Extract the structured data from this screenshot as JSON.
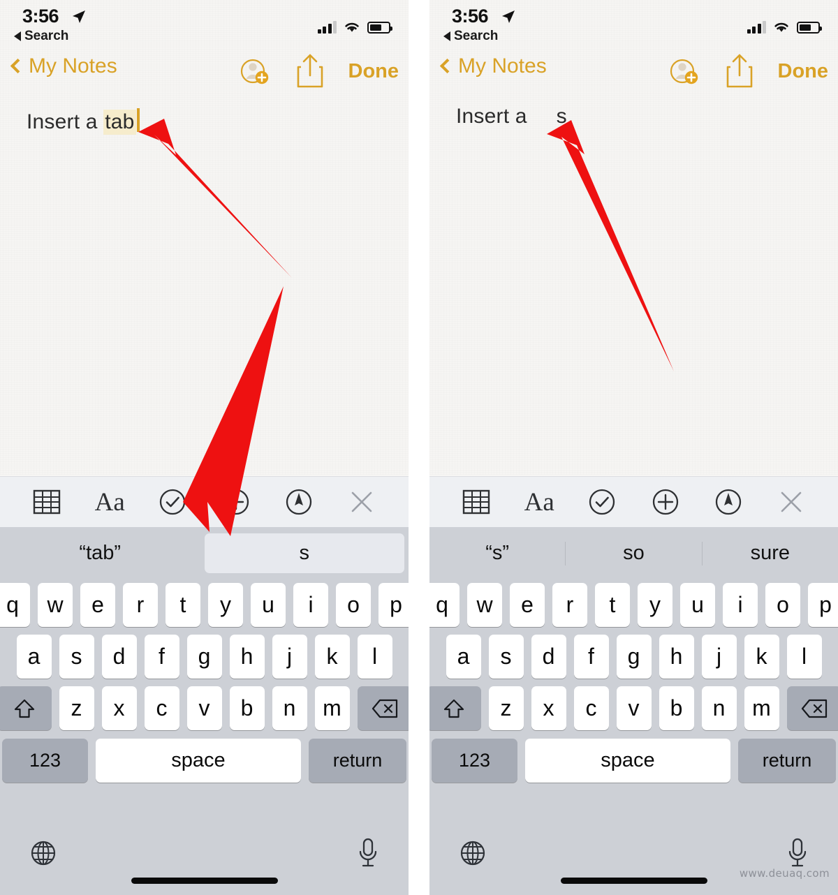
{
  "status_bar": {
    "time": "3:56",
    "back_app": "Search",
    "location_icon": "location-arrow-icon",
    "signal_icon": "cellular-signal-icon",
    "wifi_icon": "wifi-icon",
    "battery_icon": "battery-icon",
    "battery_level_pct": 62
  },
  "nav_bar": {
    "back_label": "My Notes",
    "back_chevron_icon": "chevron-left-icon",
    "add_person_icon": "add-person-icon",
    "share_icon": "share-icon",
    "done_label": "Done",
    "accent_color": "#d9a227"
  },
  "panels": [
    {
      "id": "before",
      "note": {
        "prefix": "Insert a ",
        "highlighted_word": "tab",
        "has_caret": true,
        "tab_inserted": false,
        "suffix": ""
      },
      "suggestions": [
        {
          "label": "“tab”",
          "highlighted": false
        },
        {
          "label": "s",
          "highlighted": true
        }
      ],
      "arrows": [
        {
          "name": "arrow-to-note-text",
          "points_to": "tab"
        },
        {
          "name": "arrow-to-suggestion",
          "points_to": "s"
        }
      ]
    },
    {
      "id": "after",
      "note": {
        "prefix": "Insert a",
        "highlighted_word": "",
        "has_caret": false,
        "tab_inserted": true,
        "suffix": "s"
      },
      "suggestions": [
        {
          "label": "“s”",
          "highlighted": false
        },
        {
          "label": "so",
          "highlighted": false
        },
        {
          "label": "sure",
          "highlighted": false
        }
      ],
      "arrows": [
        {
          "name": "arrow-to-note-text",
          "points_to": "s"
        }
      ]
    }
  ],
  "format_toolbar": {
    "items": [
      {
        "icon": "table-icon",
        "label": ""
      },
      {
        "icon": "text-format-icon",
        "label": "Aa"
      },
      {
        "icon": "checklist-circle-icon",
        "label": ""
      },
      {
        "icon": "plus-circle-icon",
        "label": ""
      },
      {
        "icon": "markup-pen-circle-icon",
        "label": ""
      },
      {
        "icon": "close-x-icon",
        "label": ""
      }
    ]
  },
  "keyboard": {
    "row1": [
      "q",
      "w",
      "e",
      "r",
      "t",
      "y",
      "u",
      "i",
      "o",
      "p"
    ],
    "row2": [
      "a",
      "s",
      "d",
      "f",
      "g",
      "h",
      "j",
      "k",
      "l"
    ],
    "row3": [
      "z",
      "x",
      "c",
      "v",
      "b",
      "n",
      "m"
    ],
    "shift_icon": "shift-up-arrow-icon",
    "backspace_icon": "backspace-delete-icon",
    "numbers_label": "123",
    "space_label": "space",
    "return_label": "return",
    "globe_icon": "globe-language-icon",
    "mic_icon": "microphone-dictation-icon"
  },
  "watermark": "www.deuaq.com",
  "colors": {
    "accent_gold": "#d9a227",
    "highlight_yellow": "#f6eccc",
    "keyboard_bg": "#cdd0d6",
    "key_white": "#ffffff",
    "key_dark": "#a6abb5",
    "toolbar_bg": "#eef0f3",
    "arrow_red": "#ee1111",
    "paper_bg": "#f6f5f3"
  }
}
